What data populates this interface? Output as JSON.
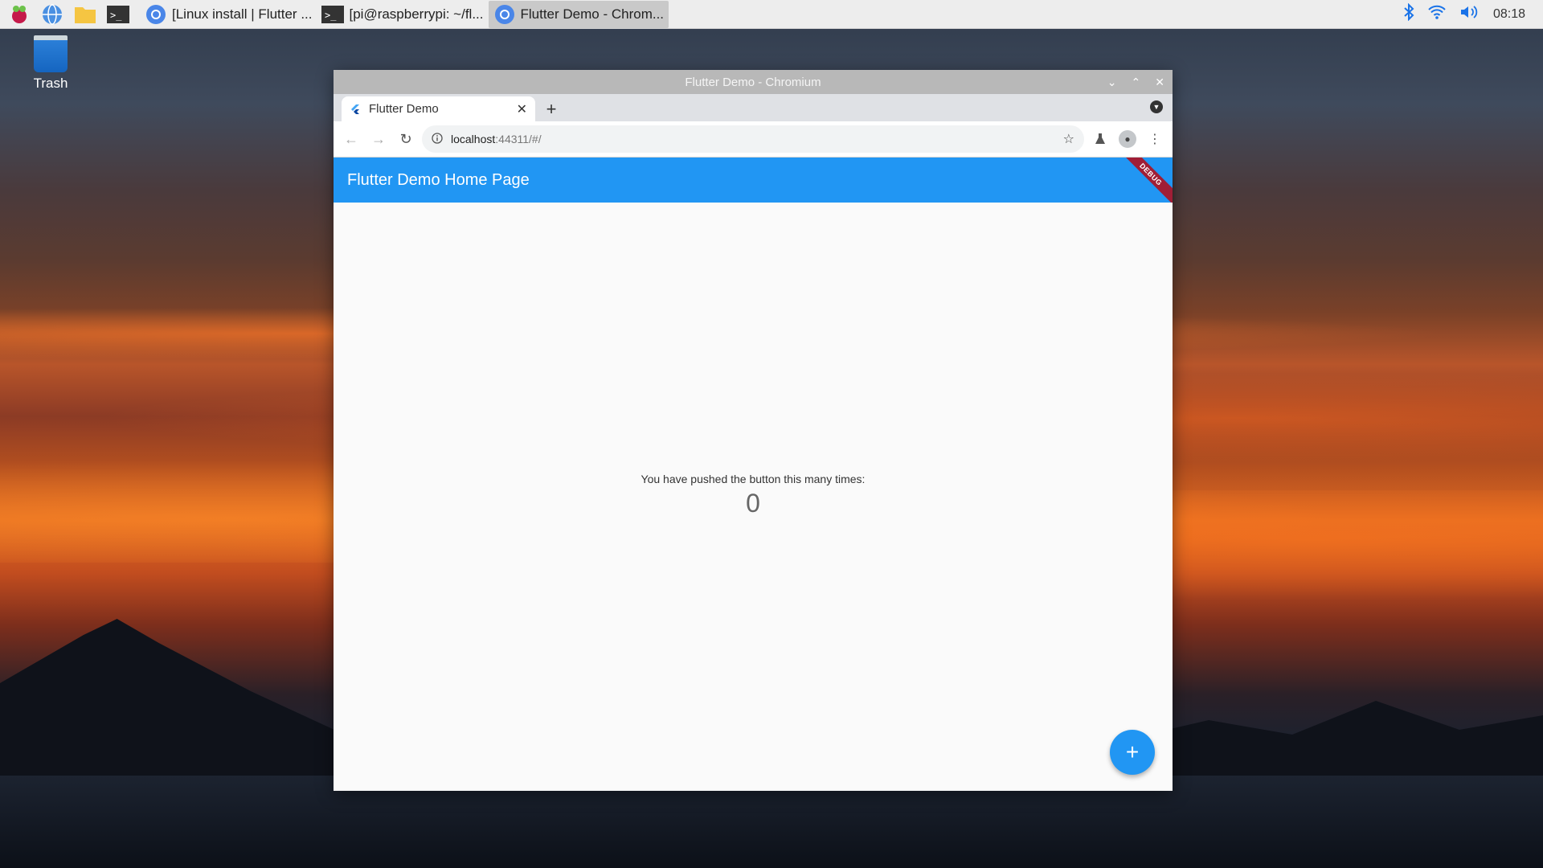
{
  "taskbar": {
    "launchers": [
      {
        "icon": "raspberry-pi-menu-icon"
      },
      {
        "icon": "web-browser-icon"
      },
      {
        "icon": "file-manager-icon"
      },
      {
        "icon": "terminal-icon"
      }
    ],
    "tasks": [
      {
        "label": "[Linux install | Flutter ...",
        "icon": "chromium-icon",
        "active": false
      },
      {
        "label": "[pi@raspberrypi: ~/fl...",
        "icon": "terminal-icon",
        "active": false
      },
      {
        "label": "Flutter Demo - Chrom...",
        "icon": "chromium-icon",
        "active": true
      }
    ],
    "clock": "08:18",
    "tray": [
      "bluetooth-icon",
      "wifi-icon",
      "volume-icon"
    ]
  },
  "desktop": {
    "trash_label": "Trash"
  },
  "browser": {
    "window_title": "Flutter Demo - Chromium",
    "tab_title": "Flutter Demo",
    "url_host": "localhost",
    "url_rest": ":44311/#/"
  },
  "app": {
    "title": "Flutter Demo Home Page",
    "debug_banner": "DEBUG",
    "message": "You have pushed the button this many times:",
    "counter": "0",
    "fab_symbol": "+"
  },
  "colors": {
    "app_primary": "#2196f3",
    "debug_ribbon": "#a01e36"
  }
}
